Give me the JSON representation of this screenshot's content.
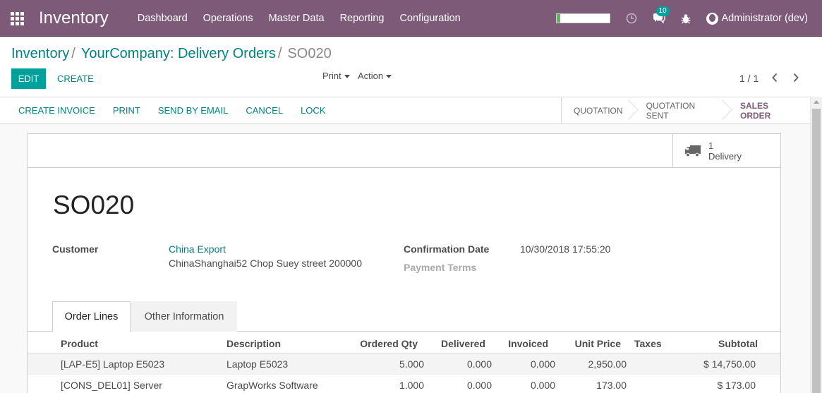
{
  "navbar": {
    "brand": "Inventory",
    "menu": [
      "Dashboard",
      "Operations",
      "Master Data",
      "Reporting",
      "Configuration"
    ],
    "progress": 0.07,
    "message_count": "10",
    "user": "Administrator (dev)"
  },
  "breadcrumb": {
    "items": [
      "Inventory",
      "YourCompany: Delivery Orders"
    ],
    "current": "SO020"
  },
  "toolbar": {
    "edit_label": "EDIT",
    "create_label": "CREATE",
    "print_label": "Print",
    "action_label": "Action"
  },
  "pager": {
    "value": "1 / 1"
  },
  "statusbar": {
    "buttons": [
      "CREATE INVOICE",
      "PRINT",
      "SEND BY EMAIL",
      "CANCEL",
      "LOCK"
    ],
    "stages": [
      "QUOTATION",
      "QUOTATION SENT",
      "SALES ORDER"
    ],
    "active_stage": "SALES ORDER"
  },
  "smart_button": {
    "value": "1",
    "label": "Delivery"
  },
  "form": {
    "title": "SO020",
    "customer_label": "Customer",
    "customer_name": "China Export",
    "customer_address": "ChinaShanghai52 Chop Suey street 200000",
    "confirmation_label": "Confirmation Date",
    "confirmation_value": "10/30/2018 17:55:20",
    "payment_terms_label": "Payment Terms"
  },
  "tabs": [
    "Order Lines",
    "Other Information"
  ],
  "order_lines": {
    "columns": [
      "Product",
      "Description",
      "Ordered Qty",
      "Delivered",
      "Invoiced",
      "Unit Price",
      "Taxes",
      "Subtotal"
    ],
    "rows": [
      {
        "product": "[LAP-E5] Laptop E5023",
        "description": "Laptop E5023",
        "ordered": "5.000",
        "delivered": "0.000",
        "invoiced": "0.000",
        "price": "2,950.00",
        "taxes": "",
        "subtotal": "$ 14,750.00"
      },
      {
        "product": "[CONS_DEL01] Server",
        "description": "GrapWorks Software",
        "ordered": "1.000",
        "delivered": "0.000",
        "invoiced": "0.000",
        "price": "173.00",
        "taxes": "",
        "subtotal": "$ 173.00"
      }
    ]
  },
  "colors": {
    "brand": "#7c5a78",
    "accent": "#00a09d",
    "link": "#00827f"
  }
}
